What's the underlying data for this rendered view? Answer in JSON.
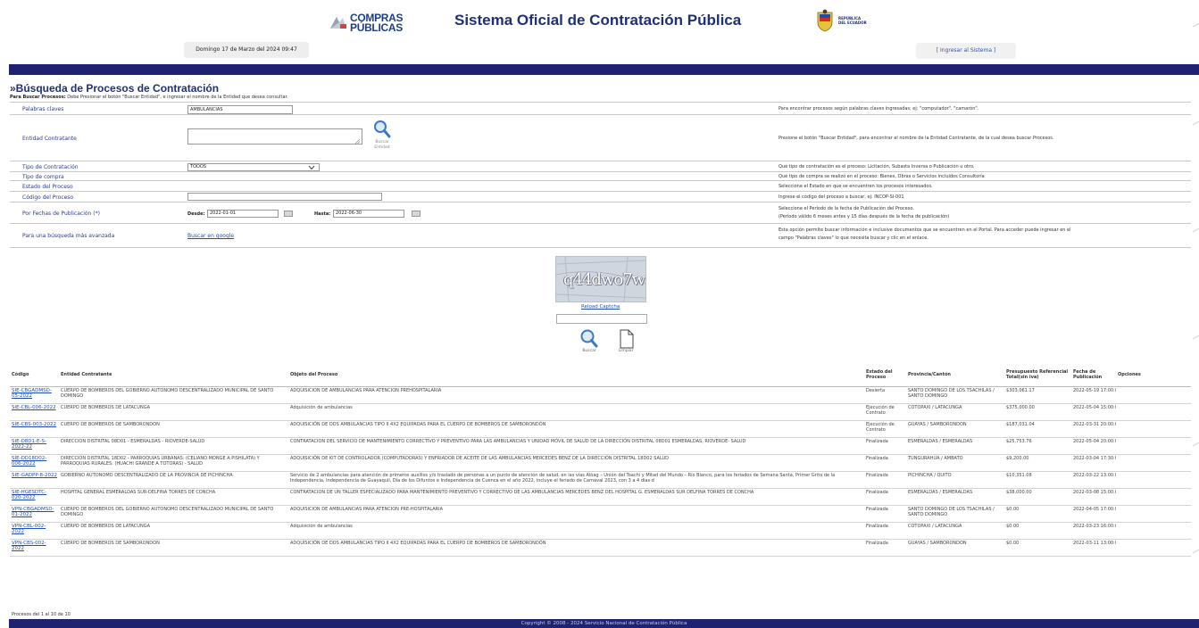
{
  "header": {
    "logo_line1": "COMPRAS",
    "logo_line2": "PÚBLICAS",
    "title": "Sistema Oficial de Contratación Pública",
    "ecuador_logo_text_1": "REPÚBLICA",
    "ecuador_logo_text_2": "DEL ECUADOR",
    "date": "Domingo 17 de Marzo del 2024 09:47",
    "login_link": "[ Ingresar al Sistema ]"
  },
  "search": {
    "title": "»Búsqueda de Procesos de Contratación",
    "instruction_bold": "Para Buscar Procesos:",
    "instruction": " Debe Presionar el botón \"Buscar Entidad\", e ingresar el nombre de la Entidad que desea consultar.",
    "fields": {
      "keywords_label": "Palabras claves",
      "keywords_value": "AMBULANCIAS",
      "keywords_help": "Para encontrar procesos según palabras claves ingresadas; ej: \"computador\", \"camarón\".",
      "entity_label": "Entidad Contratante",
      "entity_button_line1": "Buscar",
      "entity_button_line2": "Entidad",
      "entity_help": "Presione el botón \"Buscar Entidad\", para encontrar el nombre de la Entidad Contratante, de la cual desea buscar Procesos.",
      "contract_type_label": "Tipo de Contratación",
      "contract_type_value": "TODOS",
      "contract_type_help": "Qué tipo de contratación es el proceso: Licitación, Subasta Inversa o Publicación u otro.",
      "purchase_type_label": "Tipo de compra",
      "purchase_type_help": "Qué tipo de compra se realizó en el proceso: Bienes, Obras o Servicios incluidos Consultoría",
      "status_label": "Estado del Proceso",
      "status_help": "Seleccione el Estado en que se encuentren los procesos interesados.",
      "code_label": "Código del Proceso",
      "code_help": "Ingrese el código del proceso a buscar, ej: INCOP-SI-001",
      "dates_label": "Por Fechas de Publicación (*)",
      "from_label": "Desde:",
      "from_value": "2022-01-01",
      "to_label": "Hasta:",
      "to_value": "2022-06-30",
      "dates_help_1": "Seleccione el Período de la fecha de Publicación del Proceso.",
      "dates_help_2": "(Período válido 6 meses antes y 15 días después de la fecha de publicación)",
      "advanced_label": "Para una búsqueda más avanzada",
      "advanced_link": "Buscar en google",
      "advanced_help_1": "Esta opción permite buscar información e inclusive documentos que se encuentren en el Portal. Para acceder puede ingresar en el",
      "advanced_help_2": "campo \"Palabras claves\" lo que necesita buscar y clic en el enlace."
    },
    "captcha_text": "q44dwo7w",
    "reload_captcha": "Reload Captcha",
    "search_button": "Buscar",
    "clear_button": "Limpiar"
  },
  "results": {
    "headers": [
      "Código",
      "Entidad Contratante",
      "Objeto del Proceso",
      "Estado del Proceso",
      "Provincia/Cantón",
      "Presupuesto Referencial Total(sin iva)",
      "Fecha de Publicación",
      "Opciones"
    ],
    "rows": [
      {
        "code": "SIE-CBGADMSD-05-2022",
        "entity": "CUERPO DE BOMBEROS DEL GOBIERNO AUTONOMO DESCENTRALIZADO MUNICIPAL DE SANTO DOMINGO",
        "object": "ADQUISICION DE AMBULANCIAS PARA ATENCION PREHOSPITALARIA",
        "status": "Desierta",
        "location": "SANTO DOMINGO DE LOS TSACHILAS / SANTO DOMINGO",
        "budget": "$303,061.17",
        "date": "2022-05-19 17:00:00"
      },
      {
        "code": "SIE-CBL-006-2022",
        "entity": "CUERPO DE BOMBEROS DE LATACUNGA",
        "object": "Adquisición de ambulancias",
        "status": "Ejecución de Contrato",
        "location": "COTOPAXI / LATACUNGA",
        "budget": "$375,000.00",
        "date": "2022-05-04 15:00:00"
      },
      {
        "code": "SIE-CBS-003-2022",
        "entity": "CUERPO DE BOMBEROS DE SAMBORONDON",
        "object": "ADQUISICIÓN DE DOS AMBULANCIAS TIPO II 4X2 EQUIPADAS PARA EL CUERPO DE BOMBEROS DE SAMBORONDÓN",
        "status": "Ejecución de Contrato",
        "location": "GUAYAS / SAMBORONDON",
        "budget": "$187,031.04",
        "date": "2022-03-31 20:00:00"
      },
      {
        "code": "SIE-D8D1-E-S-2022-22",
        "entity": "DIRECCION DISTRITAL 08D01 - ESMERALDAS - RIOVERDE-SALUD",
        "object": "CONTRATACION DEL SERVICIO DE MANTENIMIENTO CORRECTIVO Y PREVENTIVO PARA LAS AMBULANCIAS Y UNIDAD MÓVIL DE SALUD DE LA DIRECCIÓN DISTRITAL 08D01 ESMERALDAS, RIOVERDE- SALUD",
        "status": "Finalizada",
        "location": "ESMERALDAS / ESMERALDAS",
        "budget": "$25,753.76",
        "date": "2022-05-04 20:00:00"
      },
      {
        "code": "SIE-DD18D02-006-2022",
        "entity": "DIRECCION DISTRITAL 18D02 - PARROQUIAS URBANAS: (CELIANO MONGE A PISHILATA) Y PARROQUIAS RURALES: (HUACHI GRANDE A TOTORAS) - SALUD",
        "object": "ADQUISICIÓN DE KIT DE CONTROLADOR (COMPUTADORAS) Y ENFRIADOR DE ACEITE DE LAS AMBULANCIAS MERCEDES BENZ DE LA DIRECCIÓN DISTRITAL 18D02 SALUD",
        "status": "Finalizada",
        "location": "TUNGURAHUA / AMBATO",
        "budget": "$9,200.00",
        "date": "2022-03-04 17:30:00"
      },
      {
        "code": "SIE-GADPP-8-2022",
        "entity": "GOBIERNO AUTONOMO DESCENTRALIZADO DE LA PROVINCIA DE PICHINCHA",
        "object": "Servicio de 2 ambulancias para atención de primeros auxilios y/o traslado de personas a un punto de atención de salud, en las vías Alóag – Unión del Toachi y Mitad del Mundo – Río Blanco, para los feriados de Semana Santa, Primer Grito de la Independencia, Independencia de Guayaquil, Día de los Difuntos e Independencia de Cuenca en el año 2022, incluye el feriado de Carnaval 2023, con 3 a 4 días d",
        "status": "Finalizada",
        "location": "PICHINCHA / QUITO",
        "budget": "$10,351.08",
        "date": "2022-03-22 13:00:00"
      },
      {
        "code": "SIE-HGESDTC-020-2022",
        "entity": "HOSPITAL GENERAL ESMERALDAS SUR-DELFINA TORRES DE CONCHA",
        "object": "CONTRATACION DE UN TALLER ESPECIALIZADO PARA MANTENIMIENTO PREVENTIVO Y CORRECTIVO DE LAS AMBULANCIAS MERCEDES BENZ DEL HOSPITAL G. ESMERALDAS SUR DELFINA TORRES DE CONCHA",
        "status": "Finalizada",
        "location": "ESMERALDAS / ESMERALDAS",
        "budget": "$38,000.00",
        "date": "2022-03-08 15:00:00"
      },
      {
        "code": "VPN-CBGADMSD-01-2022",
        "entity": "CUERPO DE BOMBEROS DEL GOBIERNO AUTONOMO DESCENTRALIZADO MUNICIPAL DE SANTO DOMINGO",
        "object": "ADQUISICION DE AMBULANCIAS PARA ATENCION PRE-HOSPITALARIA",
        "status": "Finalizada",
        "location": "SANTO DOMINGO DE LOS TSACHILAS / SANTO DOMINGO",
        "budget": "$0.00",
        "date": "2022-04-05 17:00:00"
      },
      {
        "code": "VPN-CBL-002-2022",
        "entity": "CUERPO DE BOMBEROS DE LATACUNGA",
        "object": "Adquisición de ambulancias",
        "status": "Finalizada",
        "location": "COTOPAXI / LATACUNGA",
        "budget": "$0.00",
        "date": "2022-03-23 16:00:00"
      },
      {
        "code": "VPN-CBS-002-2022",
        "entity": "CUERPO DE BOMBEROS DE SAMBORONDON",
        "object": "ADQUISICIÓN DE DOS AMBULANCIAS TIPO II 4X2 EQUIPADAS PARA EL CUERPO DE BOMBEROS DE SAMBORONDÓN",
        "status": "Finalizada",
        "location": "GUAYAS / SAMBORONDON",
        "budget": "$0.00",
        "date": "2022-03-11 13:00:00"
      }
    ],
    "count_text": "Procesos del 1 al 10 de 10"
  },
  "footer": {
    "copyright": "Copyright © 2008 - 2024 Servicio Nacional de Contratación Pública"
  }
}
